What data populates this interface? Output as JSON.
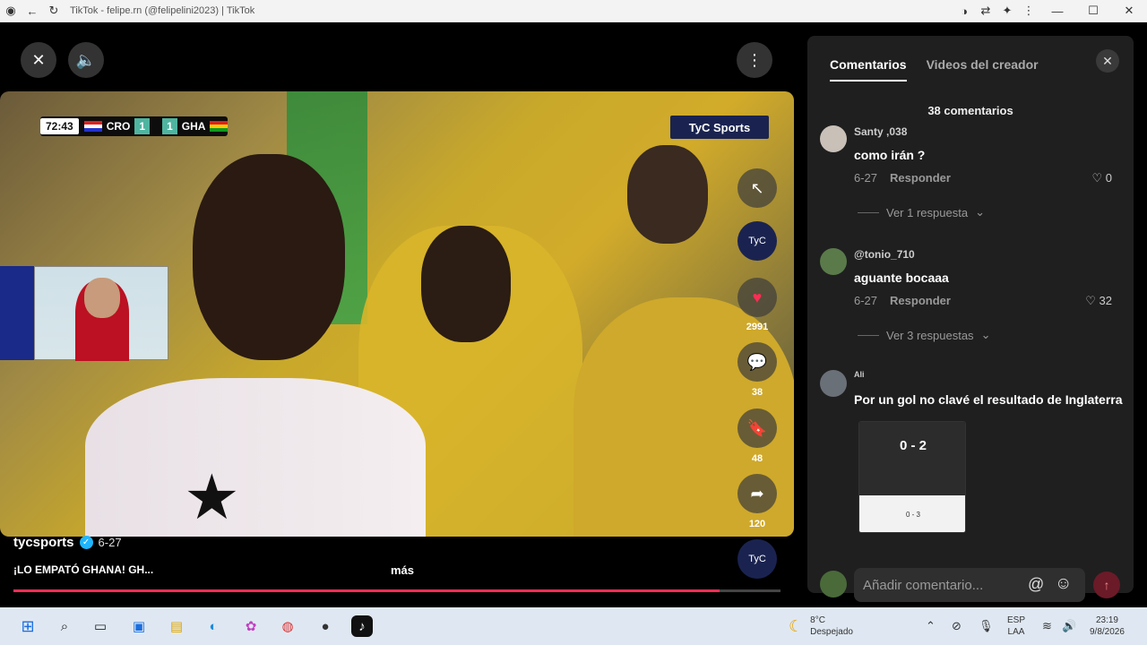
{
  "browser": {
    "title": "TikTok - felipe.rn (@felipelini2023) | TikTok"
  },
  "video": {
    "scoreboard": {
      "time": "72:43",
      "team_home": "CRO",
      "score_home": "1",
      "score_away": "1",
      "team_away": "GHA"
    },
    "channel_logo": "TyC Sports",
    "username": "tycsports",
    "date": "6-27",
    "caption": "¡LO EMPATÓ GHANA! GH...",
    "more_label": "más",
    "progress": 0.92,
    "likes": "2991",
    "comments": "38",
    "saves": "48",
    "shares": "120"
  },
  "panel": {
    "tabs": [
      {
        "label": "Comentarios",
        "active": true
      },
      {
        "label": "Videos del creador",
        "active": false
      }
    ],
    "count_label": "38 comentarios",
    "comments": [
      {
        "user": "Santy ,038",
        "text": "como irán ?",
        "date": "6-27",
        "reply_label": "Responder",
        "likes": "0",
        "replies": "Ver 1 respuesta"
      },
      {
        "user": "@tonio_710",
        "text": "aguante bocaaa",
        "date": "6-27",
        "reply_label": "Responder",
        "likes": "32",
        "replies": "Ver 3 respuestas"
      },
      {
        "user": "Ali",
        "text": "Por un gol no clavé el resultado de Inglaterra"
      }
    ],
    "attachment": {
      "score": "0 - 2",
      "score_small": "0 - 3"
    },
    "input_placeholder": "Añadir comentario..."
  },
  "taskbar": {
    "weather_temp": "8°C",
    "weather_desc": "Despejado",
    "lang": "ESP",
    "lang_sub": "LAA",
    "time": "23:19",
    "date": "9/8/2026"
  }
}
